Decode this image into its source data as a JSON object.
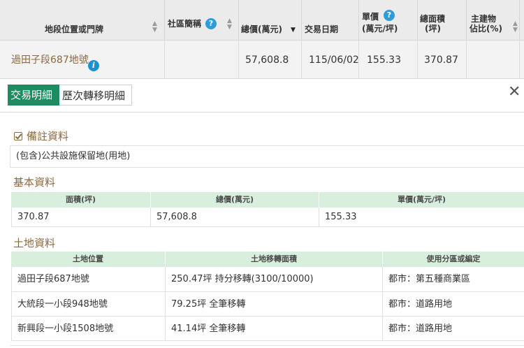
{
  "top_table": {
    "headers": {
      "location": "地段位置或門牌",
      "community": "社區簡稱",
      "total_price": "總價(萬元)",
      "trade_date": "交易日期",
      "unit_price_l1": "單價",
      "unit_price_l2": "(萬元/坪)",
      "area_l1": "總面積",
      "area_l2": "(坪)",
      "main_l1": "主建物",
      "main_l2": "佔比(%)"
    },
    "row": {
      "location": "過田子段687地號",
      "community": "",
      "total_price": "57,608.8",
      "trade_date": "115/06/02",
      "unit_price": "155.33",
      "area": "370.87",
      "main_ratio": ""
    }
  },
  "icons": {
    "help": "?",
    "info": "i",
    "close": "✕",
    "sort_up": "▲",
    "sort_down": "▼"
  },
  "tabs": {
    "trade": "交易明細",
    "history": "歷次轉移明細"
  },
  "remarks": {
    "title": "備註資料",
    "text": "(包含)公共設施保留地(用地)"
  },
  "basic": {
    "title": "基本資料",
    "headers": [
      "面積(坪)",
      "總價(萬元)",
      "單價(萬元/坪)"
    ],
    "values": [
      "370.87",
      "57,608.8",
      "155.33"
    ]
  },
  "land": {
    "title": "土地資料",
    "headers": [
      "土地位置",
      "土地移轉面積",
      "使用分區或編定"
    ],
    "rows": [
      [
        "過田子段687地號",
        "250.47坪 持分移轉(3100/10000)",
        "都市：第五種商業區"
      ],
      [
        "大統段一小段948地號",
        "79.25坪 全筆移轉",
        "都市：道路用地"
      ],
      [
        "新興段一小段1508地號",
        "41.14坪 全筆移轉",
        "都市：道路用地"
      ]
    ]
  },
  "colors": {
    "tab_active": "#1e8c5e",
    "grid_header": "#d8efdd",
    "section_title": "#8a6a3e",
    "link": "#8a6a3e",
    "help_icon": "#2f9cd8"
  }
}
